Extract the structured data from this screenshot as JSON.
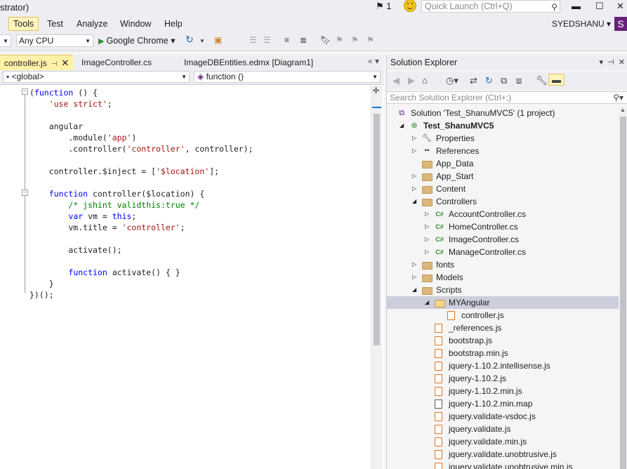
{
  "window": {
    "title_fragment": "strator)",
    "notification_count": "1"
  },
  "quick_launch": {
    "placeholder": "Quick Launch (Ctrl+Q)"
  },
  "menu": {
    "items": [
      "Tools",
      "Test",
      "Analyze",
      "Window",
      "Help"
    ],
    "active": "Tools"
  },
  "user": {
    "name": "SYEDSHANU",
    "badge": "S"
  },
  "toolbar": {
    "platform": "Any CPU",
    "run_target": "Google Chrome"
  },
  "editor": {
    "tabs": [
      {
        "label": "controller.js",
        "active": true
      },
      {
        "label": "ImageController.cs",
        "active": false
      },
      {
        "label": "ImageDBEntities.edmx [Diagram1]",
        "active": false
      }
    ],
    "nav_scope": "<global>",
    "nav_member": "function ()"
  },
  "code_lines": [
    [
      {
        "t": "(",
        "c": ""
      },
      {
        "t": "function",
        "c": "kw"
      },
      {
        "t": " () {",
        "c": ""
      }
    ],
    [
      {
        "t": "    ",
        "c": ""
      },
      {
        "t": "'use strict'",
        "c": "str"
      },
      {
        "t": ";",
        "c": ""
      }
    ],
    [],
    [
      {
        "t": "    angular",
        "c": ""
      }
    ],
    [
      {
        "t": "        .module(",
        "c": ""
      },
      {
        "t": "'app'",
        "c": "str"
      },
      {
        "t": ")",
        "c": ""
      }
    ],
    [
      {
        "t": "        .controller(",
        "c": ""
      },
      {
        "t": "'controller'",
        "c": "str"
      },
      {
        "t": ", controller);",
        "c": ""
      }
    ],
    [],
    [
      {
        "t": "    controller.$inject = [",
        "c": ""
      },
      {
        "t": "'$location'",
        "c": "str"
      },
      {
        "t": "];",
        "c": ""
      }
    ],
    [],
    [
      {
        "t": "    ",
        "c": ""
      },
      {
        "t": "function",
        "c": "kw"
      },
      {
        "t": " controller($location) {",
        "c": ""
      }
    ],
    [
      {
        "t": "        ",
        "c": ""
      },
      {
        "t": "/* jshint validthis:true */",
        "c": "com"
      }
    ],
    [
      {
        "t": "        ",
        "c": ""
      },
      {
        "t": "var",
        "c": "kw"
      },
      {
        "t": " vm = ",
        "c": ""
      },
      {
        "t": "this",
        "c": "kw"
      },
      {
        "t": ";",
        "c": ""
      }
    ],
    [
      {
        "t": "        vm.title = ",
        "c": ""
      },
      {
        "t": "'controller'",
        "c": "str"
      },
      {
        "t": ";",
        "c": ""
      }
    ],
    [],
    [
      {
        "t": "        activate();",
        "c": ""
      }
    ],
    [],
    [
      {
        "t": "        ",
        "c": ""
      },
      {
        "t": "function",
        "c": "kw"
      },
      {
        "t": " activate() { }",
        "c": ""
      }
    ],
    [
      {
        "t": "    }",
        "c": ""
      }
    ],
    [
      {
        "t": "})();",
        "c": ""
      }
    ]
  ],
  "solution_explorer": {
    "title": "Solution Explorer",
    "search_placeholder": "Search Solution Explorer (Ctrl+;)",
    "tree": [
      {
        "label": "Solution 'Test_ShanuMVC5' (1 project)",
        "depth": 0,
        "icon": "sln",
        "exp": ""
      },
      {
        "label": "Test_ShanuMVC5",
        "depth": 1,
        "icon": "proj",
        "exp": "open",
        "bold": true
      },
      {
        "label": "Properties",
        "depth": 2,
        "icon": "wrench",
        "exp": "closed"
      },
      {
        "label": "References",
        "depth": 2,
        "icon": "refs",
        "exp": "closed"
      },
      {
        "label": "App_Data",
        "depth": 2,
        "icon": "folder",
        "exp": ""
      },
      {
        "label": "App_Start",
        "depth": 2,
        "icon": "folder",
        "exp": "closed"
      },
      {
        "label": "Content",
        "depth": 2,
        "icon": "folder",
        "exp": "closed"
      },
      {
        "label": "Controllers",
        "depth": 2,
        "icon": "folder",
        "exp": "open"
      },
      {
        "label": "AccountController.cs",
        "depth": 3,
        "icon": "cs",
        "exp": "closed"
      },
      {
        "label": "HomeController.cs",
        "depth": 3,
        "icon": "cs",
        "exp": "closed"
      },
      {
        "label": "ImageController.cs",
        "depth": 3,
        "icon": "cs",
        "exp": "closed"
      },
      {
        "label": "ManageController.cs",
        "depth": 3,
        "icon": "cs",
        "exp": "closed"
      },
      {
        "label": "fonts",
        "depth": 2,
        "icon": "folder",
        "exp": "closed"
      },
      {
        "label": "Models",
        "depth": 2,
        "icon": "folder",
        "exp": "closed"
      },
      {
        "label": "Scripts",
        "depth": 2,
        "icon": "folder",
        "exp": "open"
      },
      {
        "label": "MYAngular",
        "depth": 3,
        "icon": "folder-open",
        "exp": "open",
        "selected": true
      },
      {
        "label": "controller.js",
        "depth": 4,
        "icon": "js",
        "exp": ""
      },
      {
        "label": "_references.js",
        "depth": 3,
        "icon": "js",
        "exp": ""
      },
      {
        "label": "bootstrap.js",
        "depth": 3,
        "icon": "js",
        "exp": ""
      },
      {
        "label": "bootstrap.min.js",
        "depth": 3,
        "icon": "js",
        "exp": ""
      },
      {
        "label": "jquery-1.10.2.intellisense.js",
        "depth": 3,
        "icon": "js",
        "exp": ""
      },
      {
        "label": "jquery-1.10.2.js",
        "depth": 3,
        "icon": "js",
        "exp": ""
      },
      {
        "label": "jquery-1.10.2.min.js",
        "depth": 3,
        "icon": "js",
        "exp": ""
      },
      {
        "label": "jquery-1.10.2.min.map",
        "depth": 3,
        "icon": "file",
        "exp": ""
      },
      {
        "label": "jquery.validate-vsdoc.js",
        "depth": 3,
        "icon": "js",
        "exp": ""
      },
      {
        "label": "jquery.validate.js",
        "depth": 3,
        "icon": "js",
        "exp": ""
      },
      {
        "label": "jquery.validate.min.js",
        "depth": 3,
        "icon": "js",
        "exp": ""
      },
      {
        "label": "jquery.validate.unobtrusive.js",
        "depth": 3,
        "icon": "js",
        "exp": ""
      },
      {
        "label": "jquery.validate.unobtrusive.min.js",
        "depth": 3,
        "icon": "js",
        "exp": ""
      }
    ]
  },
  "colors": {
    "accent": "#007acc",
    "selection": "#cccedb",
    "active_tab": "#fff1a8",
    "keyword": "#0000ff",
    "string": "#a31515",
    "comment": "#008000"
  }
}
